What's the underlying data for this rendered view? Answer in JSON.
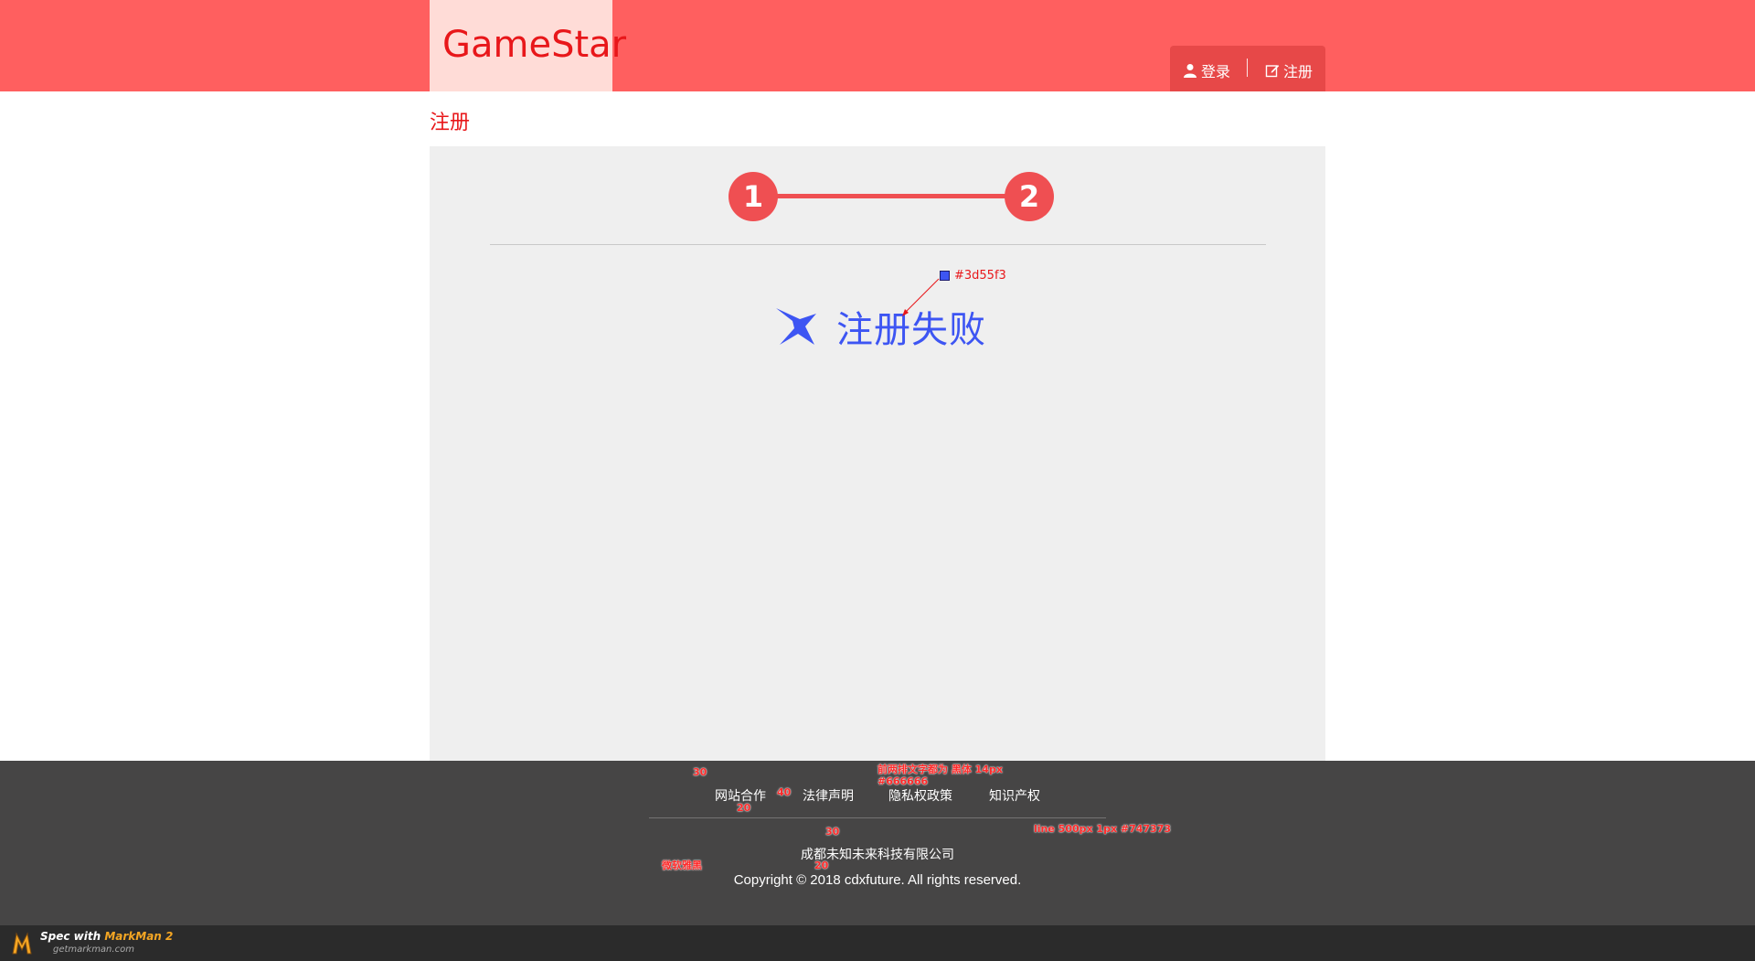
{
  "header": {
    "logo": "GameStar",
    "login_label": "登录",
    "register_label": "注册",
    "login_icon": "user-icon",
    "register_icon": "edit-icon"
  },
  "page": {
    "title": "注册"
  },
  "steps": {
    "step1": "1",
    "step2": "2"
  },
  "result": {
    "icon": "x-icon",
    "text": "注册失败",
    "color": "#3d55f3"
  },
  "annotations": {
    "color_label": "#3d55f3",
    "gap_30_top": "30",
    "gap_40": "40",
    "gap_20_a": "20",
    "font_note": "前两排文字都为  黑体 14px",
    "font_color": "#666666",
    "line_note": "line 500px 1px #747373",
    "gap_30_mid": "30",
    "gap_20_b": "20",
    "font_name": "微软雅黑"
  },
  "footer": {
    "links": [
      "网站合作",
      "法律声明",
      "隐私权政策",
      "知识产权"
    ],
    "company": "成都未知未来科技有限公司",
    "copyright": "Copyright © 2018 cdxfuture. All rights reserved."
  },
  "markman": {
    "line1_prefix": "Spec with ",
    "line1_brand": "MarkMan 2",
    "line2": "getmarkman.com"
  },
  "colors": {
    "header_bg": "#ff5f5f",
    "accent_red": "#e8171a",
    "step_red": "#ef4f52",
    "fail_blue": "#3d55f3",
    "footer_bg": "#464545"
  }
}
